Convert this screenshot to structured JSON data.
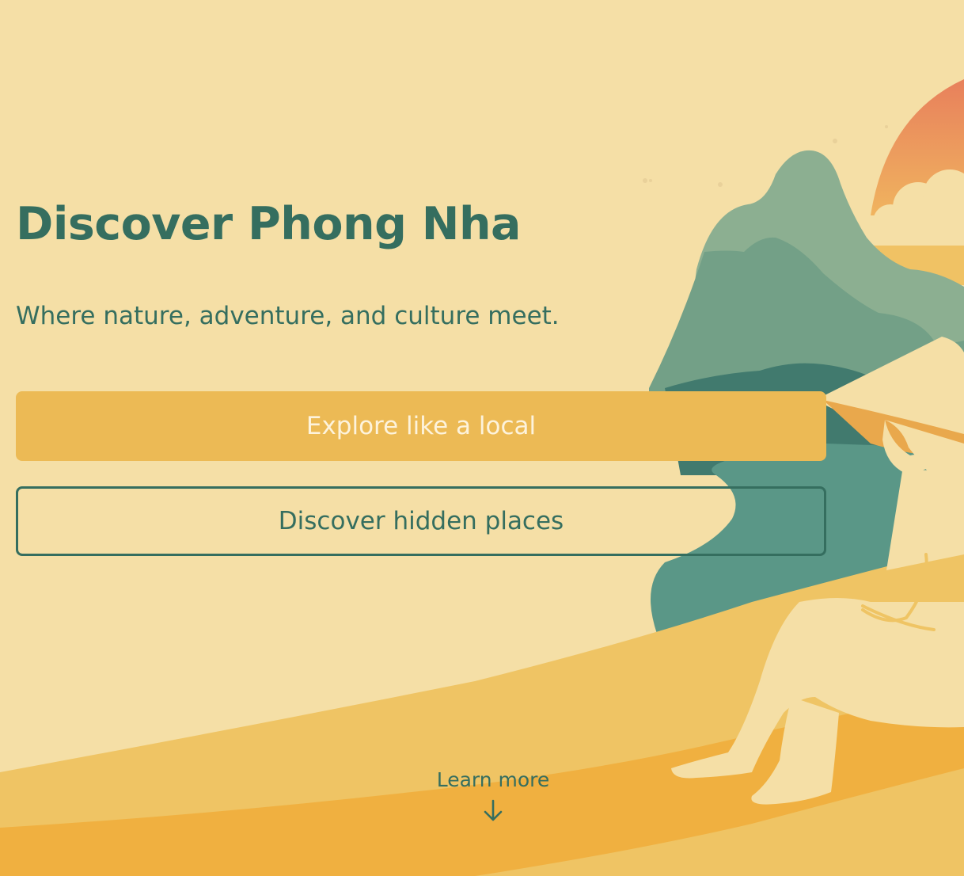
{
  "hero": {
    "title": "Discover Phong Nha",
    "subtitle": "Where nature, adventure, and culture meet."
  },
  "actions": {
    "primary_label": "Explore like a local",
    "secondary_label": "Discover hidden places"
  },
  "scroll_hint": {
    "label": "Learn more",
    "icon": "arrow-down-icon"
  },
  "colors": {
    "background": "#f5dfa6",
    "text_green": "#356e5f",
    "button_gold": "#ecba55",
    "button_text": "#fdf3dc",
    "sun_top": "#e8805c",
    "sun_bottom": "#f0b45f",
    "mountain_light": "#8caf91",
    "mountain_mid": "#73a087",
    "mountain_dark": "#417a6e",
    "lake_teal": "#5a9787",
    "sand_light": "#efc464",
    "sand_orange": "#f0b040"
  },
  "illustration": {
    "name": "person-sitting-by-lake-illustration"
  }
}
